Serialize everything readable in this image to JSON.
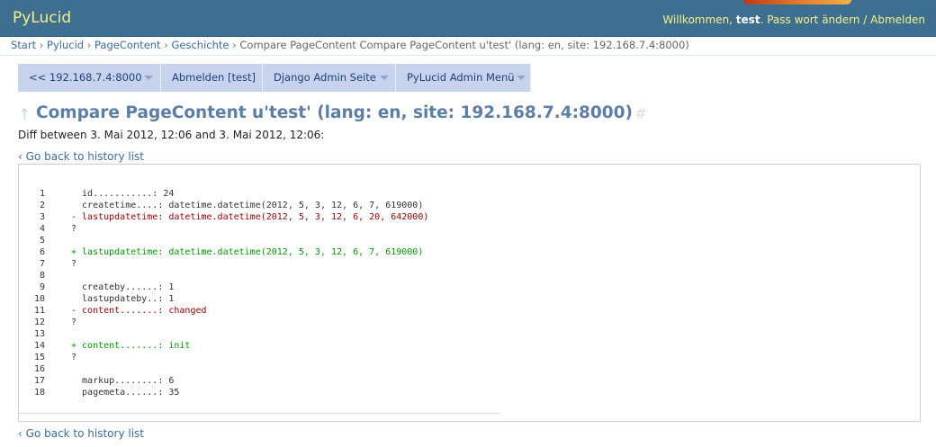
{
  "header": {
    "logo": "PyLucid",
    "welcome_prefix": "Willkommen, ",
    "username": "test",
    "welcome_suffix": ".",
    "change_password": "Pass wort ändern",
    "separator": " / ",
    "logout": "Abmelden",
    "background_color": "#3e6f90",
    "logo_color": "#f6ef8a"
  },
  "breadcrumb": {
    "items": [
      "Start",
      "Pylucid",
      "PageContent",
      "Geschichte"
    ],
    "separator": "›",
    "current": "Compare PageContent Compare PageContent u'test' (lang: en, site: 192.168.7.4:8000)"
  },
  "menu": {
    "items": [
      {
        "label": "<< 192.168.7.4:8000",
        "has_dropdown": true
      },
      {
        "label": "Abmelden [test]",
        "has_dropdown": false
      },
      {
        "label": "Django Admin Seite",
        "has_dropdown": true
      },
      {
        "label": "PyLucid Admin Menü",
        "has_dropdown": true
      }
    ],
    "background_color": "#c7d3ed"
  },
  "page": {
    "up_icon": "up-arrow-icon",
    "title": "Compare PageContent u'test' (lang: en, site: 192.168.7.4:8000)",
    "permalink": "#",
    "subtitle": "Diff between 3. Mai 2012, 12:06 and 3. Mai 2012, 12:06:",
    "back_link_chevron": "‹",
    "back_link": "Go back to history list",
    "title_color": "#5b7fa6"
  },
  "diff": {
    "lines": [
      {
        "num": "1",
        "type": "ctx",
        "text": "  id...........: 24"
      },
      {
        "num": "2",
        "type": "ctx",
        "text": "  createtime....: datetime.datetime(2012, 5, 3, 12, 6, 7, 619000)"
      },
      {
        "num": "3",
        "type": "del",
        "text": "- lastupdatetime: datetime.datetime(2012, 5, 3, 12, 6, 20, 642000)"
      },
      {
        "num": "4",
        "type": "ctx",
        "text": "?"
      },
      {
        "num": "5",
        "type": "ctx",
        "text": ""
      },
      {
        "num": "6",
        "type": "add",
        "text": "+ lastupdatetime: datetime.datetime(2012, 5, 3, 12, 6, 7, 619000)"
      },
      {
        "num": "7",
        "type": "ctx",
        "text": "?"
      },
      {
        "num": "8",
        "type": "ctx",
        "text": ""
      },
      {
        "num": "9",
        "type": "ctx",
        "text": "  createby......: 1"
      },
      {
        "num": "10",
        "type": "ctx",
        "text": "  lastupdateby..: 1"
      },
      {
        "num": "11",
        "type": "del",
        "text": "- content.......: changed"
      },
      {
        "num": "12",
        "type": "ctx",
        "text": "?"
      },
      {
        "num": "13",
        "type": "ctx",
        "text": ""
      },
      {
        "num": "14",
        "type": "add",
        "text": "+ content.......: init"
      },
      {
        "num": "15",
        "type": "ctx",
        "text": "?"
      },
      {
        "num": "16",
        "type": "ctx",
        "text": ""
      },
      {
        "num": "17",
        "type": "ctx",
        "text": "  markup........: 6"
      },
      {
        "num": "18",
        "type": "ctx",
        "text": "  pagemeta......: 35"
      }
    ],
    "delete_color": "#a00000",
    "insert_color": "#009a00"
  }
}
